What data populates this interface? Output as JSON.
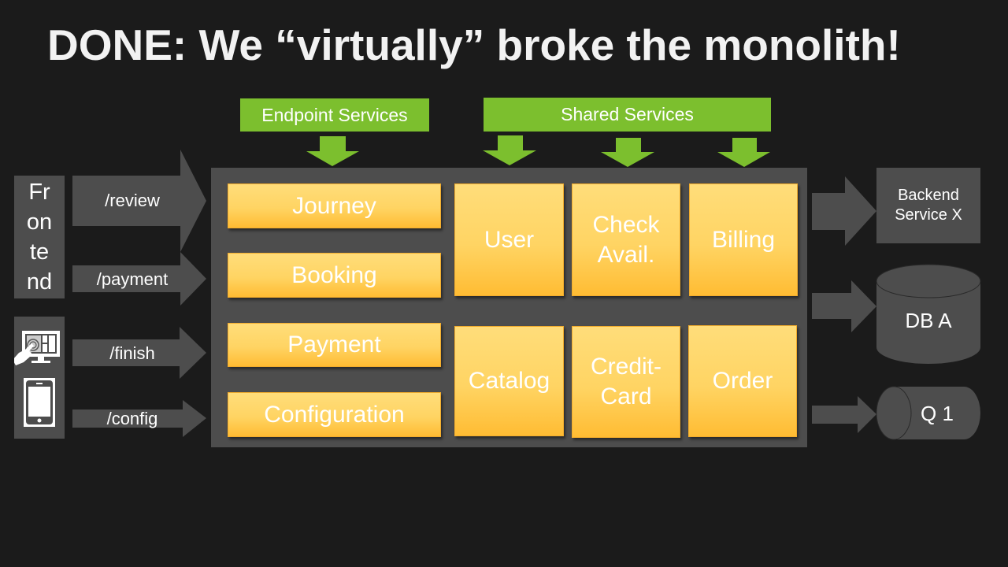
{
  "slide": {
    "title": "DONE: We “virtually” broke the monolith!"
  },
  "colors": {
    "background": "#1b1b1b",
    "gray": "#4d4d4d",
    "green": "#7cbf2e",
    "service_orange_top": "#ffdd7a",
    "service_orange_bottom": "#ffbc33"
  },
  "clients": {
    "frontend_lines": [
      "Fr",
      "on",
      "te",
      "nd"
    ],
    "devices": [
      {
        "icon": "touchscreen-monitor-icon"
      },
      {
        "icon": "smartphone-icon"
      }
    ]
  },
  "endpoints": [
    {
      "label": "/review"
    },
    {
      "label": "/payment"
    },
    {
      "label": "/finish"
    },
    {
      "label": "/config"
    }
  ],
  "groups": {
    "endpoint_services_label": "Endpoint Services",
    "shared_services_label": "Shared Services"
  },
  "endpoint_services": [
    {
      "label": "Journey"
    },
    {
      "label": "Booking"
    },
    {
      "label": "Payment"
    },
    {
      "label": "Configuration"
    }
  ],
  "shared_services": [
    {
      "lines": [
        "User"
      ]
    },
    {
      "lines": [
        "Check",
        "Avail."
      ]
    },
    {
      "lines": [
        "Billing"
      ]
    },
    {
      "lines": [
        "Catalog"
      ]
    },
    {
      "lines": [
        "Credit-",
        "Card"
      ]
    },
    {
      "lines": [
        "Order"
      ]
    }
  ],
  "backends": {
    "service": {
      "lines": [
        "Backend",
        "Service X"
      ]
    },
    "database": {
      "label": "DB A"
    },
    "queue": {
      "label": "Q 1"
    }
  }
}
